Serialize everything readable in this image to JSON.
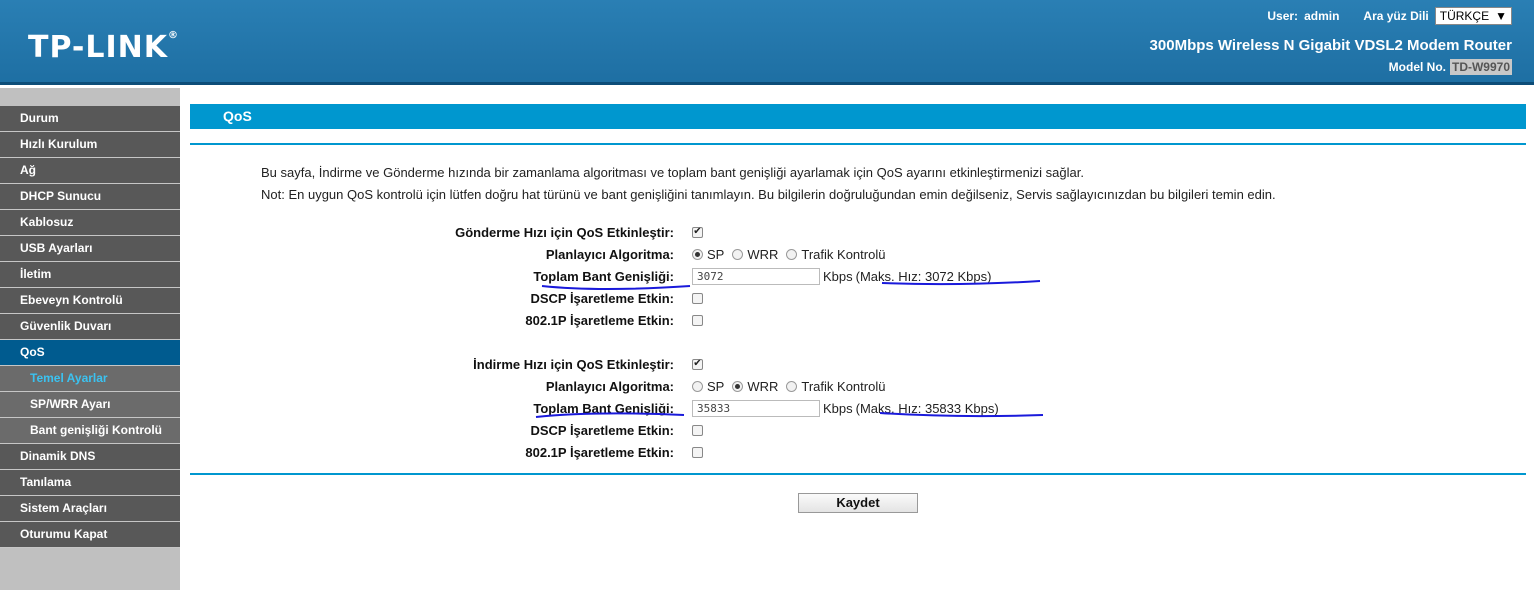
{
  "header": {
    "logo": "TP-LINK",
    "logo_mark": "®",
    "user_label": "User:",
    "user_name": "admin",
    "lang_label": "Ara yüz Dili",
    "lang_value": "TÜRKÇE",
    "product_name": "300Mbps Wireless N Gigabit VDSL2 Modem Router",
    "model_label": "Model No.",
    "model_value": "TD-W9970"
  },
  "sidebar": {
    "items": [
      {
        "label": "Durum"
      },
      {
        "label": "Hızlı Kurulum"
      },
      {
        "label": "Ağ"
      },
      {
        "label": "DHCP Sunucu"
      },
      {
        "label": "Kablosuz"
      },
      {
        "label": "USB Ayarları"
      },
      {
        "label": "İletim"
      },
      {
        "label": "Ebeveyn Kontrolü"
      },
      {
        "label": "Güvenlik Duvarı"
      },
      {
        "label": "QoS"
      },
      {
        "label": "Temel Ayarlar"
      },
      {
        "label": "SP/WRR Ayarı"
      },
      {
        "label": "Bant genişliği Kontrolü"
      },
      {
        "label": "Dinamik DNS"
      },
      {
        "label": "Tanılama"
      },
      {
        "label": "Sistem Araçları"
      },
      {
        "label": "Oturumu Kapat"
      }
    ]
  },
  "main": {
    "title": "QoS",
    "desc1": "Bu sayfa, İndirme ve Gönderme hızında bir zamanlama algoritması ve toplam bant genişliği ayarlamak için QoS ayarını etkinleştirmenizi sağlar.",
    "desc2": "Not: En uygun QoS kontrolü için lütfen doğru hat türünü ve bant genişliğini tanımlayın. Bu bilgilerin doğruluğundan emin değilseniz, Servis sağlayıcınızdan bu bilgileri temin edin.",
    "upload": {
      "enable_label": "Gönderme Hızı için QoS Etkinleştir:",
      "enable_checked": true,
      "algo_label": "Planlayıcı Algoritma:",
      "algo_options": [
        "SP",
        "WRR",
        "Trafik Kontrolü"
      ],
      "algo_selected": "SP",
      "bw_label": "Toplam Bant Genişliği:",
      "bw_value": "3072",
      "bw_unit": "Kbps",
      "bw_max": "(Maks. Hız: 3072 Kbps)",
      "dscp_label": "DSCP İşaretleme Etkin:",
      "dot1p_label": "802.1P İşaretleme Etkin:"
    },
    "download": {
      "enable_label": "İndirme Hızı için QoS Etkinleştir:",
      "enable_checked": true,
      "algo_label": "Planlayıcı Algoritma:",
      "algo_options": [
        "SP",
        "WRR",
        "Trafik Kontrolü"
      ],
      "algo_selected": "WRR",
      "bw_label": "Toplam Bant Genişliği:",
      "bw_value": "35833",
      "bw_unit": "Kbps",
      "bw_max": "(Maks. Hız: 35833 Kbps)",
      "dscp_label": "DSCP İşaretleme Etkin:",
      "dot1p_label": "802.1P İşaretleme Etkin:"
    },
    "save_label": "Kaydet"
  },
  "colors": {
    "accent": "#0097cf",
    "header": "#1e6fa3",
    "menu": "#585858",
    "menu_active": "#005b8f",
    "annotation": "#1a1adb"
  }
}
